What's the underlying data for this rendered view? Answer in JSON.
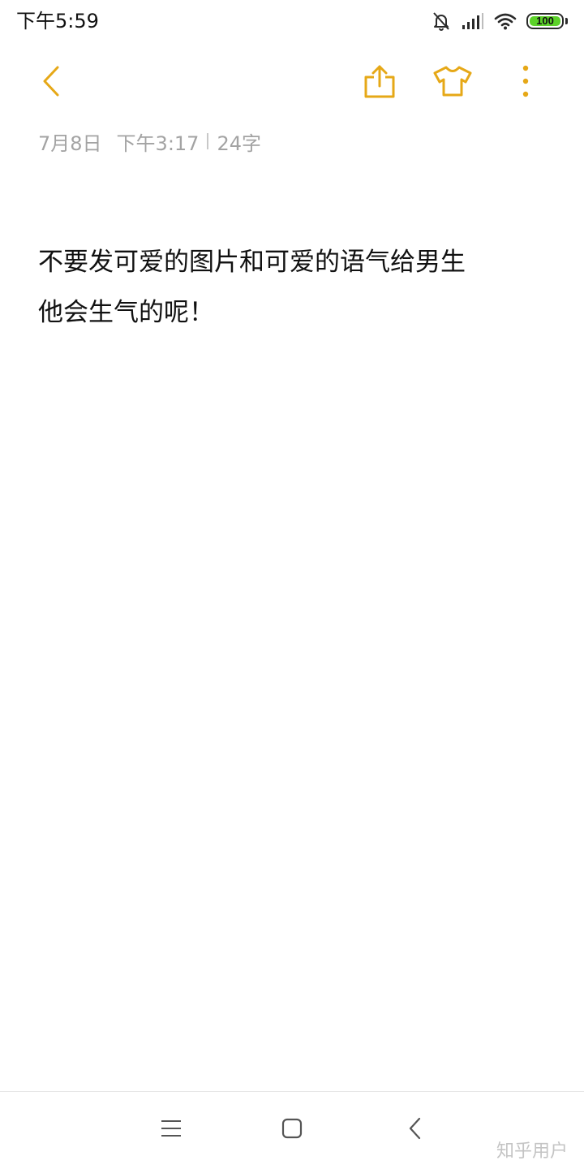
{
  "status_bar": {
    "time": "下午5:59",
    "battery_level": "100",
    "battery_fraction": 1.0,
    "battery_color": "#5cd229",
    "icons": [
      "mute-bell-icon",
      "cellular-signal-icon",
      "wifi-icon",
      "battery-icon"
    ]
  },
  "toolbar": {
    "accent_color": "#e6a817",
    "icons": [
      "back-arrow-icon",
      "share-icon",
      "theme-shirt-icon",
      "more-vertical-icon"
    ]
  },
  "note": {
    "date": "7月8日",
    "time": "下午3:17",
    "char_count": "24字",
    "lines": [
      "不要发可爱的图片和可爱的语气给男生",
      "他会生气的呢！"
    ]
  },
  "navigation": {
    "icons": [
      "menu-icon",
      "home-icon",
      "back-icon"
    ]
  },
  "watermark": "知乎用户"
}
